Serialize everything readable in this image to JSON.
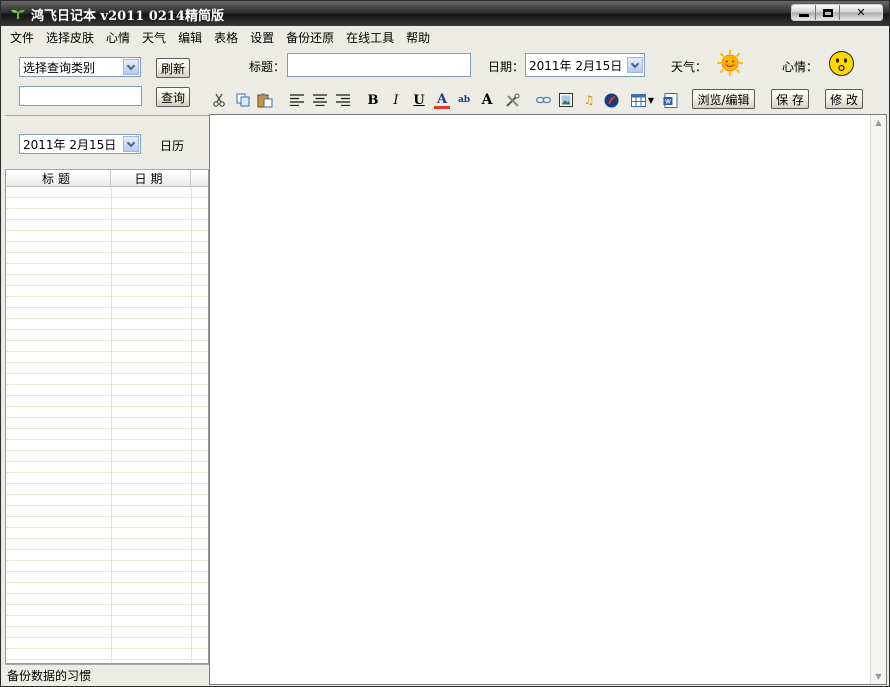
{
  "window": {
    "title": "鸿飞日记本 v2011 0214精简版"
  },
  "menu": [
    "文件",
    "选择皮肤",
    "心情",
    "天气",
    "编辑",
    "表格",
    "设置",
    "备份还原",
    "在线工具",
    "帮助"
  ],
  "left": {
    "category_select": "选择查询类别",
    "refresh_label": "刷新",
    "search_value": "",
    "query_label": "查询",
    "date_value": "2011年 2月15日",
    "calendar_label": "日历",
    "columns": [
      "标题",
      "日期"
    ]
  },
  "entry": {
    "title_label": "标题：",
    "title_value": "",
    "date_label": "日期：",
    "date_value": "2011年 2月15日",
    "weather_label": "天气：",
    "mood_label": "心情："
  },
  "toolbar": {
    "icons": [
      "cut-icon",
      "copy-icon",
      "paste-icon",
      "align-left-icon",
      "align-center-icon",
      "align-right-icon",
      "bold-icon",
      "italic-icon",
      "underline-icon",
      "font-color-icon",
      "highlight-icon",
      "font-size-icon",
      "tools-icon",
      "link-icon",
      "image-icon",
      "music-icon",
      "flash-icon",
      "table-icon",
      "word-icon"
    ],
    "browse_edit_label": "浏览/编辑",
    "save_label": "保 存",
    "modify_label": "修 改"
  },
  "status": {
    "text": "备份数据的习惯"
  },
  "colors": {
    "titlebar": "#1a1a1a",
    "panel": "#ecece4",
    "accent_blue": "#7f9db9",
    "sun": "#f5b400"
  }
}
